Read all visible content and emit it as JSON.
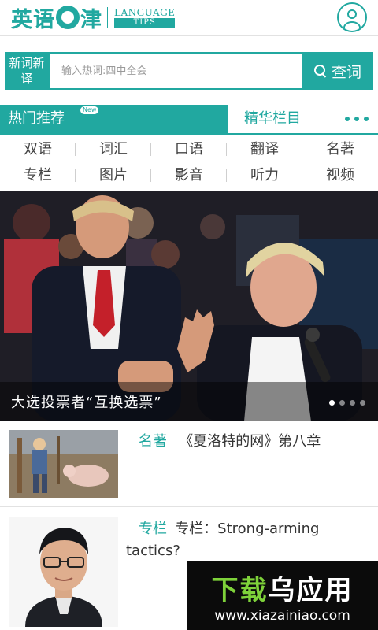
{
  "header": {
    "logo_cn_left": "英语",
    "logo_cn_right": "津",
    "logo_en_top": "LANGUAGE",
    "logo_en_bottom": "TIPS",
    "brand_color": "#21a8a0"
  },
  "search": {
    "tag": "新词新译",
    "placeholder": "输入热词:四中全会",
    "button_label": "查词"
  },
  "tabs": {
    "active": "热门推荐",
    "new_badge": "New",
    "inactive": "精华栏目"
  },
  "categories": [
    "双语",
    "词汇",
    "口语",
    "翻译",
    "名著",
    "专栏",
    "图片",
    "影音",
    "听力",
    "视频"
  ],
  "banner": {
    "caption": "大选投票者“互换选票”",
    "slide_count": 4,
    "active_slide": 1
  },
  "list": [
    {
      "category": "名著",
      "title": "《夏洛特的网》第八章"
    },
    {
      "category": "专栏",
      "title": "专栏：Strong-arming tactics?"
    }
  ],
  "watermark": {
    "top_green": "下载",
    "top_white": "乌应用",
    "url": "www.xiazainiao.com"
  }
}
